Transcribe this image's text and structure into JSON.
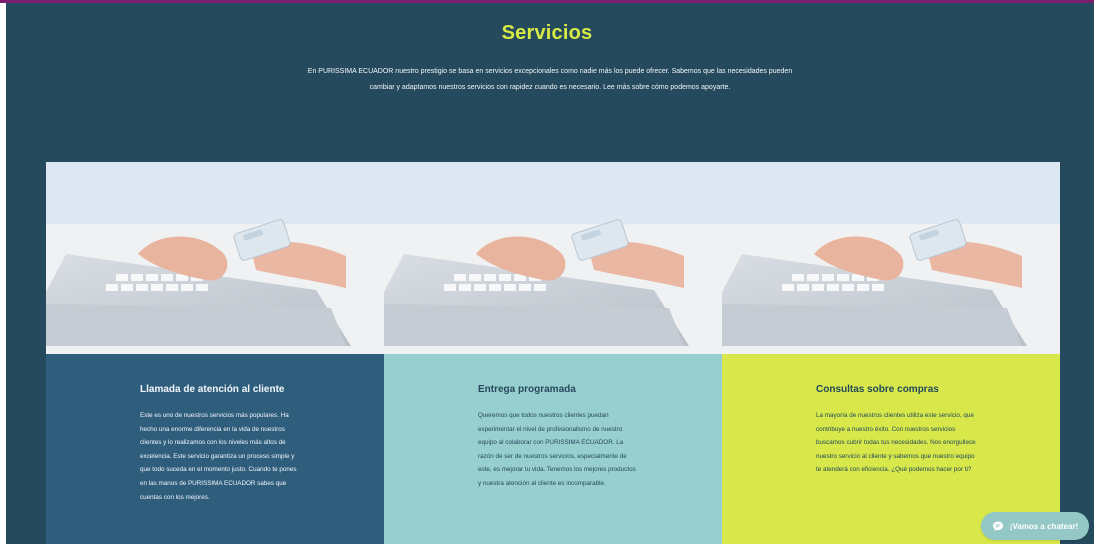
{
  "section": {
    "title": "Servicios",
    "intro": "En PURISSIMA ECUADOR nuestro prestigio se basa en servicios excepcionales como nadie más los puede ofrecer. Sabemos que las necesidades pueden cambiar y adaptamos nuestros servicios con rapidez cuando es necesario. Lee más sobre cómo podemos apoyarte."
  },
  "cards": [
    {
      "title": "Llamada de atención al cliente",
      "text": "Este es uno de nuestros servicios más populares. Ha hecho una enorme diferencia en la vida de nuestros clientes y lo realizamos con los niveles más altos de excelencia. Este servicio garantiza un proceso simple y que todo suceda en el momento justo. Cuando te pones en las manos de PURISSIMA ECUADOR sabes que cuentas con los mejores.",
      "color": "#2f5e7d"
    },
    {
      "title": "Entrega programada",
      "text": "Queremos que todos nuestros clientes puedan experimentar el nivel de profesionalismo de nuestro equipo al colaborar con PURISSIMA ECUADOR. La razón de ser de nuestros servicios, especialmente de este, es mejorar tu vida. Tenemos los mejores productos y nuestra atención al cliente es incomparable.",
      "color": "#97cfcf"
    },
    {
      "title": "Consultas sobre compras",
      "text": "La mayoría de nuestros clientes utiliza este servicio, que contribuye a nuestro éxito. Con nuestros servicios buscamos cubrir todas tus necesidades. Nos enorgullece nuestro servicio al cliente y sabemos que nuestro equipo te atenderá con eficiencia. ¿Qué podemos hacer por ti?",
      "color": "#d8e84a"
    }
  ],
  "chat": {
    "label": "¡Vamos a chatear!",
    "icon": "chat-bubble-icon"
  },
  "colors": {
    "background": "#254a5e",
    "accent": "#d7ea45",
    "top_bar": "#7a1f6d"
  }
}
